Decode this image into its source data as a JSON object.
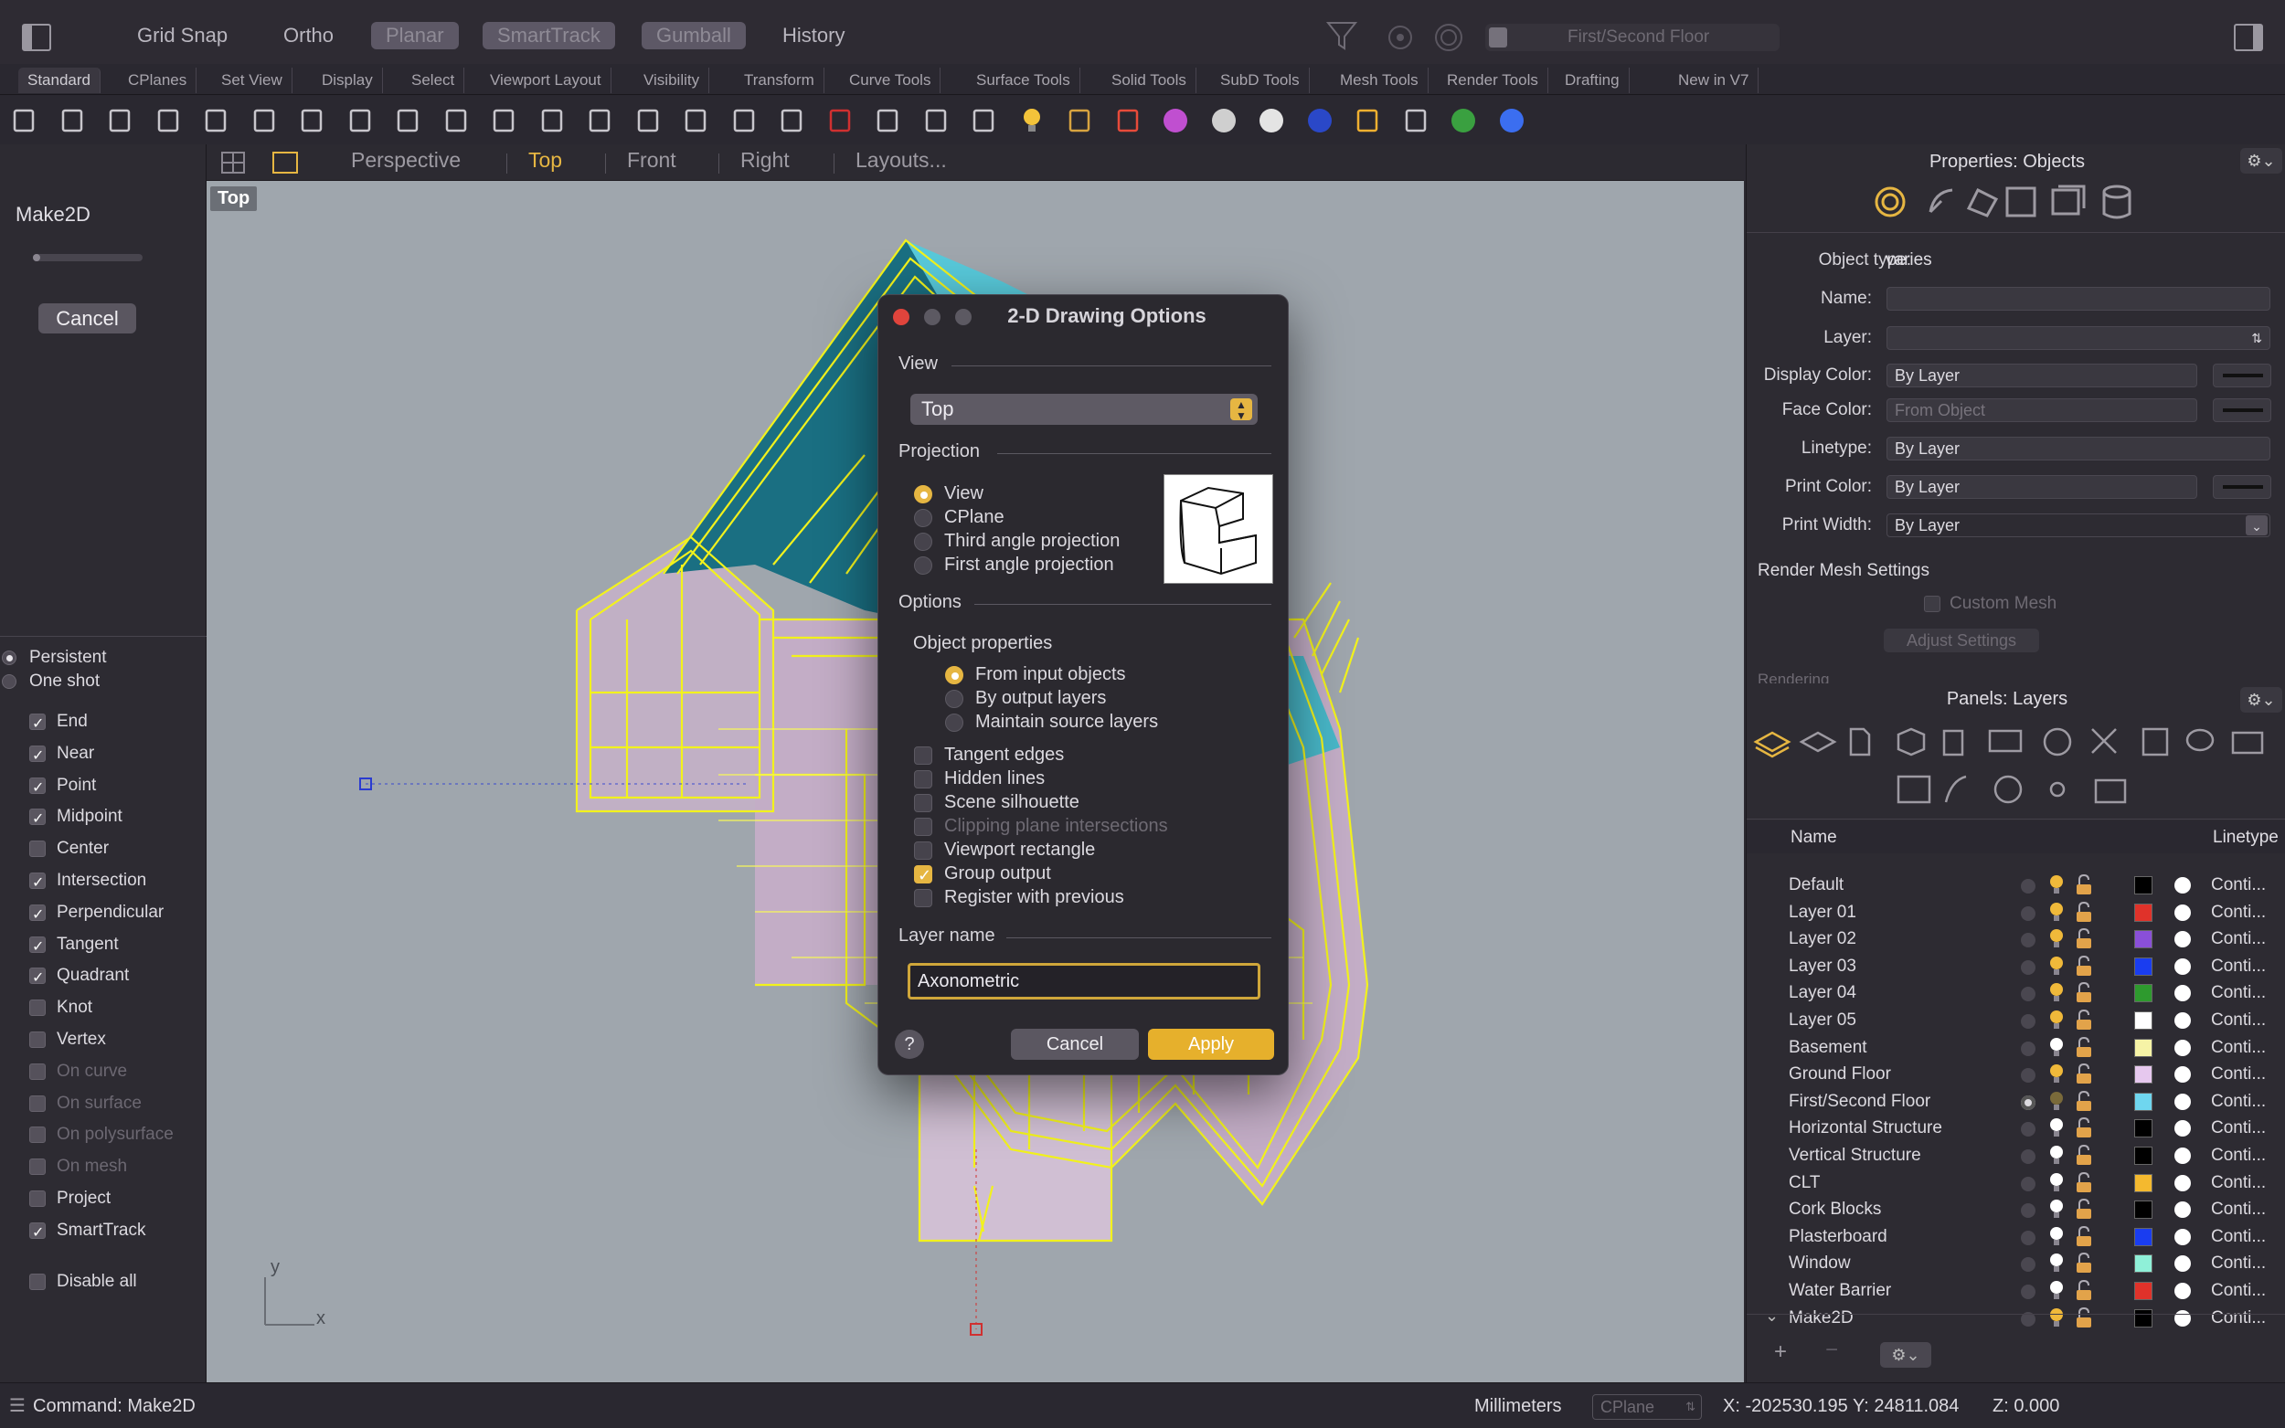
{
  "topbar": {
    "grid_snap": "Grid Snap",
    "ortho": "Ortho",
    "planar": "Planar",
    "smarttrack": "SmartTrack",
    "gumball": "Gumball",
    "history": "History",
    "layer_field": "First/Second Floor"
  },
  "tabs": [
    "Standard",
    "CPlanes",
    "Set View",
    "Display",
    "Select",
    "Viewport Layout",
    "Visibility",
    "Transform",
    "Curve Tools",
    "Surface Tools",
    "Solid Tools",
    "SubD Tools",
    "Mesh Tools",
    "Render Tools",
    "Drafting",
    "New in V7"
  ],
  "toolbar_icons": [
    "new-file-icon",
    "open-folder-icon",
    "save-icon",
    "print-icon",
    "import-icon",
    "cut-icon",
    "copy-icon",
    "paste-icon",
    "undo-icon",
    "pan-hand-icon",
    "rotate-view-icon",
    "zoom-icon",
    "zoom-window-icon",
    "zoom-extents-icon",
    "zoom-selected-icon",
    "rotate-icon",
    "four-viewports-icon",
    "car-icon",
    "grid-icon",
    "circle-snap-icon",
    "points-icon",
    "light-icon",
    "lock-icon",
    "layer-icon",
    "color-wheel-icon",
    "sphere-icon",
    "render-sphere-icon",
    "blue-sphere-icon",
    "flag-icon",
    "dimension-icon",
    "globe-icon",
    "help-icon"
  ],
  "left": {
    "command_title": "Make2D",
    "cancel": "Cancel",
    "persistent": "Persistent",
    "one_shot": "One shot",
    "osnaps": [
      {
        "label": "End",
        "checked": true,
        "enabled": true
      },
      {
        "label": "Near",
        "checked": true,
        "enabled": true
      },
      {
        "label": "Point",
        "checked": true,
        "enabled": true
      },
      {
        "label": "Midpoint",
        "checked": true,
        "enabled": true
      },
      {
        "label": "Center",
        "checked": false,
        "enabled": true
      },
      {
        "label": "Intersection",
        "checked": true,
        "enabled": true
      },
      {
        "label": "Perpendicular",
        "checked": true,
        "enabled": true
      },
      {
        "label": "Tangent",
        "checked": true,
        "enabled": true
      },
      {
        "label": "Quadrant",
        "checked": true,
        "enabled": true
      },
      {
        "label": "Knot",
        "checked": false,
        "enabled": true
      },
      {
        "label": "Vertex",
        "checked": false,
        "enabled": true
      },
      {
        "label": "On curve",
        "checked": false,
        "enabled": false
      },
      {
        "label": "On surface",
        "checked": false,
        "enabled": false
      },
      {
        "label": "On polysurface",
        "checked": false,
        "enabled": false
      },
      {
        "label": "On mesh",
        "checked": false,
        "enabled": false
      },
      {
        "label": "Project",
        "checked": false,
        "enabled": true
      },
      {
        "label": "SmartTrack",
        "checked": true,
        "enabled": true
      }
    ],
    "disable_all": "Disable all"
  },
  "viewport": {
    "tabs": [
      "Perspective",
      "Top",
      "Front",
      "Right",
      "Layouts..."
    ],
    "active_tab": "Top",
    "label": "Top",
    "axis_x": "x",
    "axis_y": "y"
  },
  "dialog": {
    "title": "2-D Drawing Options",
    "view_section": "View",
    "view_value": "Top",
    "projection_section": "Projection",
    "projection_options": [
      "View",
      "CPlane",
      "Third angle projection",
      "First angle projection"
    ],
    "projection_selected": 0,
    "options_section": "Options",
    "object_properties": "Object properties",
    "object_options": [
      "From input objects",
      "By output layers",
      "Maintain source layers"
    ],
    "object_selected": 0,
    "checks": [
      {
        "label": "Tangent edges",
        "checked": false,
        "enabled": true
      },
      {
        "label": "Hidden lines",
        "checked": false,
        "enabled": true
      },
      {
        "label": "Scene silhouette",
        "checked": false,
        "enabled": true
      },
      {
        "label": "Clipping plane intersections",
        "checked": false,
        "enabled": false
      },
      {
        "label": "Viewport rectangle",
        "checked": false,
        "enabled": true
      },
      {
        "label": "Group output",
        "checked": true,
        "enabled": true
      },
      {
        "label": "Register with previous",
        "checked": false,
        "enabled": true
      }
    ],
    "layer_name_section": "Layer name",
    "layer_name_value": "Axonometric",
    "help": "?",
    "cancel": "Cancel",
    "apply": "Apply"
  },
  "properties": {
    "header": "Properties: Objects",
    "object_type_label": "Object type:",
    "object_type_value": "varies",
    "name_label": "Name:",
    "layer_label": "Layer:",
    "display_color_label": "Display Color:",
    "display_color_value": "By Layer",
    "face_color_label": "Face Color:",
    "face_color_value": "From Object",
    "linetype_label": "Linetype:",
    "linetype_value": "By Layer",
    "print_color_label": "Print Color:",
    "print_color_value": "By Layer",
    "print_width_label": "Print Width:",
    "print_width_value": "By Layer",
    "render_mesh": "Render Mesh Settings",
    "custom_mesh": "Custom Mesh",
    "adjust_settings": "Adjust Settings",
    "rendering": "Rendering"
  },
  "layers": {
    "header": "Panels: Layers",
    "col_name": "Name",
    "col_linetype": "Linetype",
    "rows": [
      {
        "name": "Default",
        "color": "#000000",
        "bulb": "#f0b93a",
        "current": false
      },
      {
        "name": "Layer 01",
        "color": "#e0322a",
        "bulb": "#f0b93a",
        "current": false
      },
      {
        "name": "Layer 02",
        "color": "#8a4fd8",
        "bulb": "#f0b93a",
        "current": false
      },
      {
        "name": "Layer 03",
        "color": "#1a3df0",
        "bulb": "#f0b93a",
        "current": false
      },
      {
        "name": "Layer 04",
        "color": "#2e9a2e",
        "bulb": "#f0b93a",
        "current": false
      },
      {
        "name": "Layer 05",
        "color": "#ffffff",
        "bulb": "#f0b93a",
        "current": false
      },
      {
        "name": "Basement",
        "color": "#f6f3a6",
        "bulb": "#ffffff",
        "current": false
      },
      {
        "name": "Ground Floor",
        "color": "#e6c8ee",
        "bulb": "#f0b93a",
        "current": false
      },
      {
        "name": "First/Second Floor",
        "color": "#6fd6ef",
        "bulb": "#7a6a3a",
        "current": true
      },
      {
        "name": "Horizontal Structure",
        "color": "#000000",
        "bulb": "#ffffff",
        "current": false
      },
      {
        "name": "Vertical Structure",
        "color": "#000000",
        "bulb": "#ffffff",
        "current": false
      },
      {
        "name": "CLT",
        "color": "#f4b92f",
        "bulb": "#ffffff",
        "current": false
      },
      {
        "name": "Cork Blocks",
        "color": "#000000",
        "bulb": "#ffffff",
        "current": false
      },
      {
        "name": "Plasterboard",
        "color": "#1a3df0",
        "bulb": "#ffffff",
        "current": false
      },
      {
        "name": "Window",
        "color": "#8ff0d8",
        "bulb": "#ffffff",
        "current": false
      },
      {
        "name": "Water Barrier",
        "color": "#e0322a",
        "bulb": "#ffffff",
        "current": false
      },
      {
        "name": "Make2D",
        "color": "#000000",
        "bulb": "#f0b93a",
        "current": false
      }
    ],
    "linetype_value": "Conti..."
  },
  "status": {
    "command": "Command: Make2D",
    "units": "Millimeters",
    "cplane": "CPlane",
    "coords": "X: -202530.195 Y: 24811.084",
    "z": "Z: 0.000"
  }
}
